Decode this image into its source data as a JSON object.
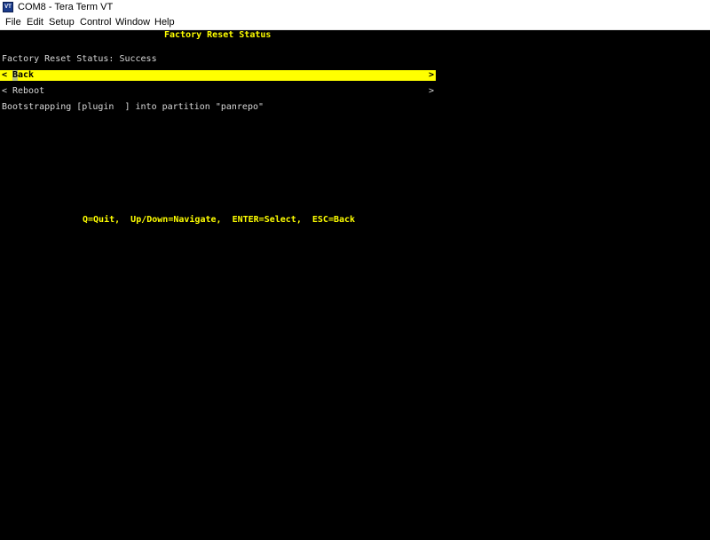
{
  "window": {
    "title": "COM8 - Tera Term VT",
    "icon_text": "VT",
    "icon_name": "tera-term-icon"
  },
  "menubar": {
    "items": [
      "File",
      "Edit",
      "Setup",
      "Control",
      "Window",
      "Help"
    ]
  },
  "terminal": {
    "header": "Factory Reset Status",
    "status_line": "Factory Reset Status: Success",
    "menu": [
      {
        "label": "Back",
        "selected": true,
        "left_glyph": "<",
        "right_glyph": ">"
      },
      {
        "label": "Reboot",
        "selected": false,
        "left_glyph": "<",
        "right_glyph": ">"
      }
    ],
    "bootstrap_line": "Bootstrapping [plugin  ] into partition \"panrepo\"",
    "help_line": "Q=Quit,  Up/Down=Navigate,  ENTER=Select,  ESC=Back"
  },
  "colors": {
    "terminal_bg": "#000000",
    "highlight": "#ffff00",
    "text": "#d8d8d8"
  }
}
